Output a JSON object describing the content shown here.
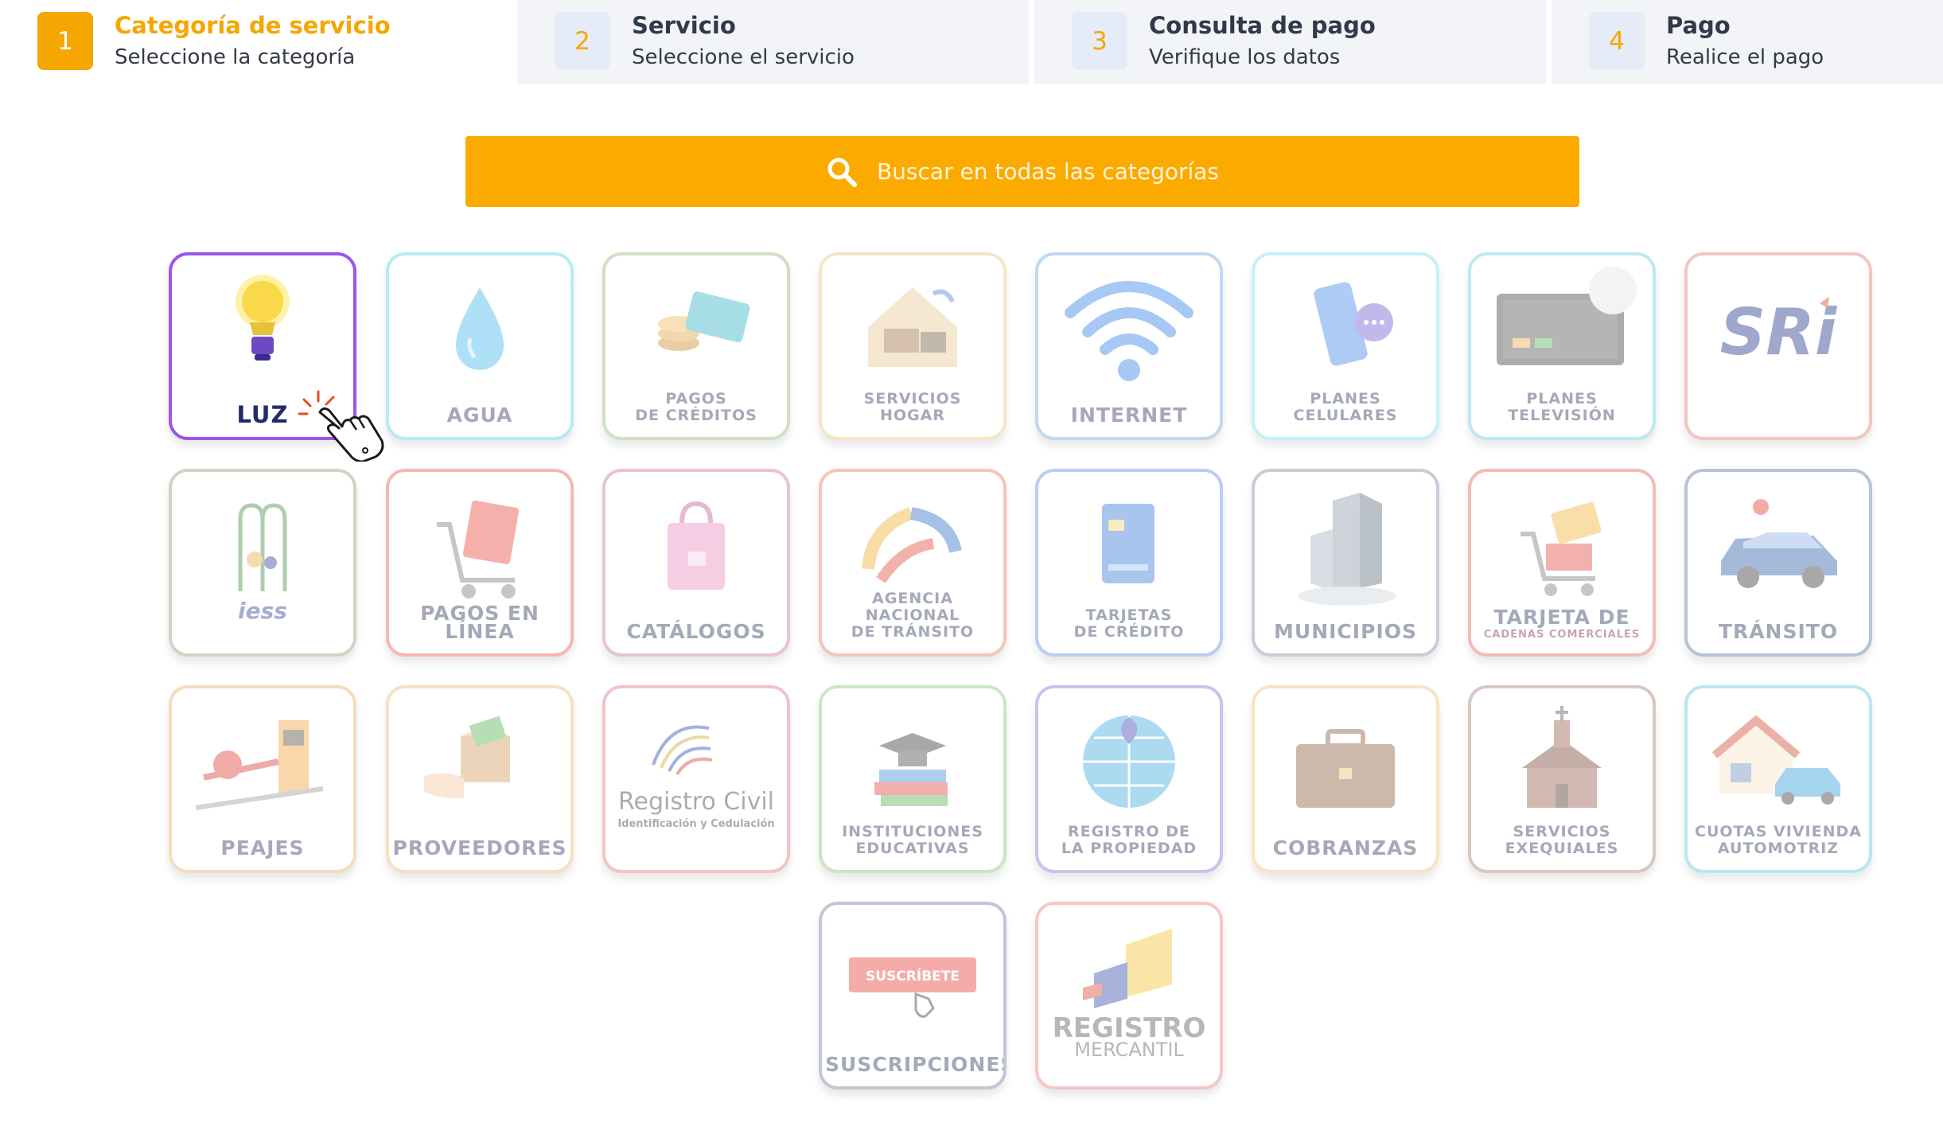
{
  "steps": [
    {
      "num": "1",
      "title": "Categoría de servicio",
      "subtitle": "Seleccione la categoría"
    },
    {
      "num": "2",
      "title": "Servicio",
      "subtitle": "Seleccione el servicio"
    },
    {
      "num": "3",
      "title": "Consulta de pago",
      "subtitle": "Verifique los datos"
    },
    {
      "num": "4",
      "title": "Pago",
      "subtitle": "Realice el pago"
    }
  ],
  "search": {
    "label": "Buscar en todas las categorías",
    "icon": "search-icon"
  },
  "categories": [
    {
      "label": "LUZ",
      "icon": "lightbulb-icon",
      "border": "#9c56e8",
      "selected": true
    },
    {
      "label": "AGUA",
      "icon": "water-drop-icon",
      "border": "#b4ecf4"
    },
    {
      "label": "PAGOS\nDE CRÉDITOS",
      "icon": "coins-card-icon",
      "border": "#cfe0c6"
    },
    {
      "label": "SERVICIOS\nHOGAR",
      "icon": "home-services-icon",
      "border": "#f4e7c7"
    },
    {
      "label": "INTERNET",
      "icon": "wifi-icon",
      "border": "#c2d8f1"
    },
    {
      "label": "PLANES\nCELULARES",
      "icon": "mobile-phone-icon",
      "border": "#c6f0f6"
    },
    {
      "label": "PLANES\nTELEVISIÓN",
      "icon": "tv-satellite-icon",
      "border": "#bfe9f0"
    },
    {
      "label": "SRi",
      "icon": "sri-logo",
      "border": "#f2c6c2"
    },
    {
      "label": "IESS",
      "icon": "iess-logo",
      "border": "#cbd7c5"
    },
    {
      "label": "PAGOS EN LÍNEA",
      "icon": "shopping-cart-icon",
      "border": "#f4b8b3"
    },
    {
      "label": "CATÁLOGOS",
      "icon": "shopping-bag-icon",
      "border": "#e9c2d6"
    },
    {
      "label": "AGENCIA\nNACIONAL\nDE TRÁNSITO",
      "icon": "ant-logo",
      "border": "#f3c6b5"
    },
    {
      "label": "TARJETAS\nDE CRÉDITO",
      "icon": "credit-card-icon",
      "border": "#b9cff0"
    },
    {
      "label": "MUNICIPIOS",
      "icon": "building-icon",
      "border": "#c6ced8"
    },
    {
      "label": "TARJETA DE",
      "sublabel": "CADENAS COMERCIALES",
      "icon": "cart-card-icon",
      "border": "#f3bcb6"
    },
    {
      "label": "TRÁNSITO",
      "icon": "car-icon",
      "border": "#b8c4d6"
    },
    {
      "label": "PEAJES",
      "icon": "toll-barrier-icon",
      "border": "#f5dbbf"
    },
    {
      "label": "PROVEEDORES",
      "icon": "delivery-box-icon",
      "border": "#f6e1c1"
    },
    {
      "label": "Registro Civil",
      "sublabel": "Identificación y Cedulación",
      "icon": "fingerprint-icon",
      "border": "#f1c4c6"
    },
    {
      "label": "INSTITUCIONES\nEDUCATIVAS",
      "icon": "graduation-books-icon",
      "border": "#cde5c6"
    },
    {
      "label": "REGISTRO DE\nLA PROPIEDAD",
      "icon": "globe-pin-icon",
      "border": "#c4c6ec"
    },
    {
      "label": "COBRANZAS",
      "icon": "briefcase-icon",
      "border": "#f8e4c4"
    },
    {
      "label": "SERVICIOS\nEXEQUIALES",
      "icon": "chapel-icon",
      "border": "#d9c8c0"
    },
    {
      "label": "CUOTAS VIVIENDA\nAUTOMOTRIZ",
      "icon": "house-car-icon",
      "border": "#b8e7ee"
    },
    {
      "label": "SUSCRIPCIONES",
      "button": "SUSCRÍBETE",
      "icon": "subscribe-button-icon",
      "border": "#c1c7d4"
    },
    {
      "label": "REGISTRO",
      "sublabel": "MERCANTIL",
      "icon": "registro-mercantil-logo",
      "border": "#f6c6c6"
    }
  ],
  "colors": {
    "accent": "#fbab00",
    "selected": "#9c56e8",
    "label_selected": "#232a6b"
  }
}
